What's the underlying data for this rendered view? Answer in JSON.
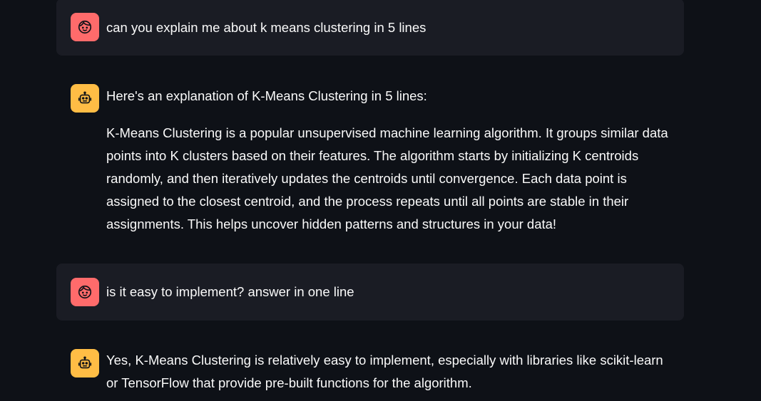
{
  "messages": [
    {
      "role": "user",
      "avatar_icon": "user-face-icon",
      "paragraphs": [
        "can you explain me about k means clustering in 5 lines"
      ]
    },
    {
      "role": "assistant",
      "avatar_icon": "robot-icon",
      "paragraphs": [
        "Here's an explanation of K-Means Clustering in 5 lines:",
        "K-Means Clustering is a popular unsupervised machine learning algorithm. It groups similar data points into K clusters based on their features. The algorithm starts by initializing K centroids randomly, and then iteratively updates the centroids until convergence. Each data point is assigned to the closest centroid, and the process repeats until all points are stable in their assignments. This helps uncover hidden patterns and structures in your data!"
      ]
    },
    {
      "role": "user",
      "avatar_icon": "user-face-icon",
      "paragraphs": [
        "is it easy to implement? answer in one line"
      ]
    },
    {
      "role": "assistant",
      "avatar_icon": "robot-icon",
      "paragraphs": [
        "Yes, K-Means Clustering is relatively easy to implement, especially with libraries like scikit-learn or TensorFlow that provide pre-built functions for the algorithm."
      ]
    }
  ],
  "colors": {
    "background": "#0e1117",
    "user_bubble": "#1a1c24",
    "user_avatar": "#ff6b6b",
    "assistant_avatar": "#ffbd45",
    "text": "#fafafa"
  }
}
